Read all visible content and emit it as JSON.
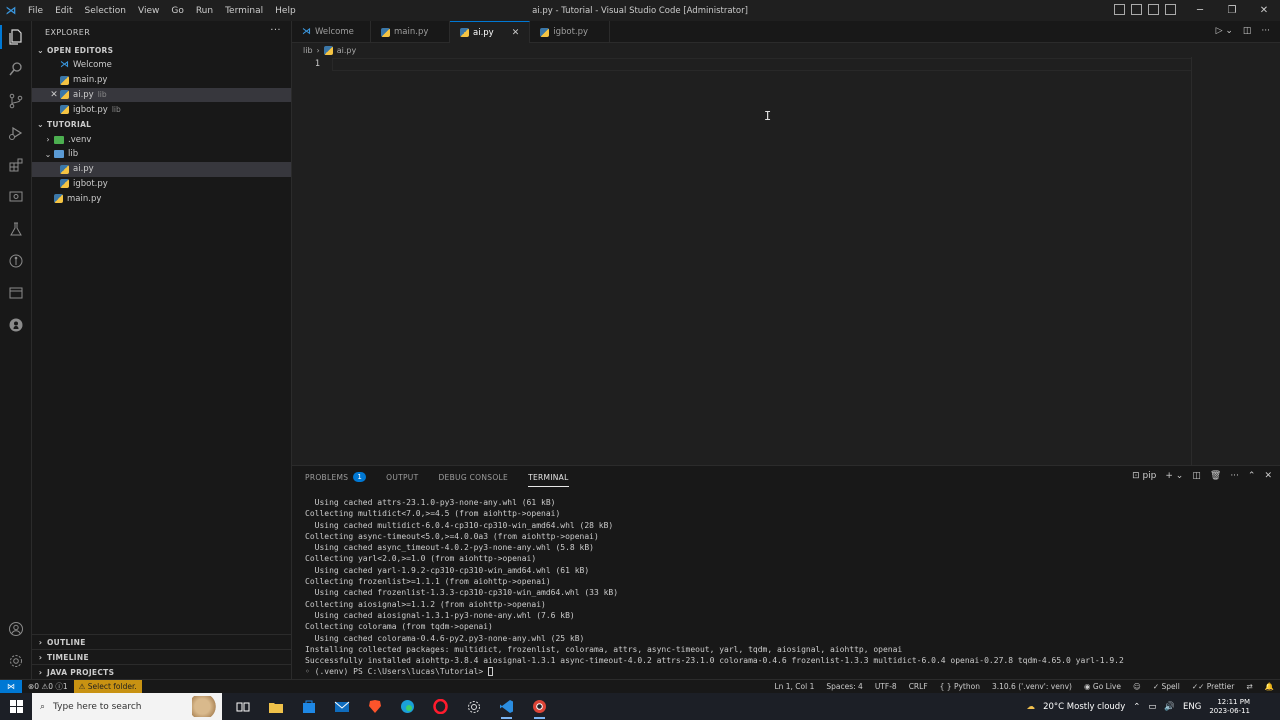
{
  "titlebar": {
    "menu": [
      "File",
      "Edit",
      "Selection",
      "View",
      "Go",
      "Run",
      "Terminal",
      "Help"
    ],
    "title": "ai.py - Tutorial - Visual Studio Code [Administrator]"
  },
  "sidebar": {
    "header": "EXPLORER",
    "open_editors": {
      "label": "OPEN EDITORS",
      "items": [
        {
          "name": "Welcome",
          "path": ""
        },
        {
          "name": "main.py",
          "path": ""
        },
        {
          "name": "ai.py",
          "path": "lib"
        },
        {
          "name": "igbot.py",
          "path": "lib"
        }
      ]
    },
    "workspace": {
      "label": "TUTORIAL",
      "venv": ".venv",
      "lib": "lib",
      "lib_files": [
        "ai.py",
        "igbot.py"
      ],
      "root_files": [
        "main.py"
      ]
    },
    "bottom_sections": [
      "OUTLINE",
      "TIMELINE",
      "JAVA PROJECTS"
    ]
  },
  "tabs": [
    "Welcome",
    "main.py",
    "ai.py",
    "igbot.py"
  ],
  "breadcrumb": {
    "folder": "lib",
    "file": "ai.py"
  },
  "editor": {
    "line_numbers": [
      "1"
    ]
  },
  "panel": {
    "tabs": [
      "PROBLEMS",
      "OUTPUT",
      "DEBUG CONSOLE",
      "TERMINAL"
    ],
    "problems_count": "1",
    "shell": "pip",
    "terminal_lines": [
      "  Using cached attrs-23.1.0-py3-none-any.whl (61 kB)",
      "Collecting multidict<7.0,>=4.5 (from aiohttp->openai)",
      "  Using cached multidict-6.0.4-cp310-cp310-win_amd64.whl (28 kB)",
      "Collecting async-timeout<5.0,>=4.0.0a3 (from aiohttp->openai)",
      "  Using cached async_timeout-4.0.2-py3-none-any.whl (5.8 kB)",
      "Collecting yarl<2.0,>=1.0 (from aiohttp->openai)",
      "  Using cached yarl-1.9.2-cp310-cp310-win_amd64.whl (61 kB)",
      "Collecting frozenlist>=1.1.1 (from aiohttp->openai)",
      "  Using cached frozenlist-1.3.3-cp310-cp310-win_amd64.whl (33 kB)",
      "Collecting aiosignal>=1.1.2 (from aiohttp->openai)",
      "  Using cached aiosignal-1.3.1-py3-none-any.whl (7.6 kB)",
      "Collecting colorama (from tqdm->openai)",
      "  Using cached colorama-0.4.6-py2.py3-none-any.whl (25 kB)",
      "Installing collected packages: multidict, frozenlist, colorama, attrs, async-timeout, yarl, tqdm, aiosignal, aiohttp, openai",
      "Successfully installed aiohttp-3.8.4 aiosignal-1.3.1 async-timeout-4.0.2 attrs-23.1.0 colorama-0.4.6 frozenlist-1.3.3 multidict-6.0.4 openai-0.27.8 tqdm-4.65.0 yarl-1.9.2"
    ],
    "prompt": "(.venv) PS C:\\Users\\lucas\\Tutorial> "
  },
  "statusbar": {
    "errors": "0",
    "warnings": "0",
    "info": "1",
    "select_folder": "Select folder.",
    "position": "Ln 1, Col 1",
    "spaces": "Spaces: 4",
    "encoding": "UTF-8",
    "eol": "CRLF",
    "language": "Python",
    "interpreter": "3.10.6 ('.venv': venv)",
    "go_live": "Go Live",
    "spell": "Spell",
    "prettier": "Prettier"
  },
  "taskbar": {
    "search_placeholder": "Type here to search",
    "weather": "20°C  Mostly cloudy",
    "language": "ENG",
    "time": "12:11 PM",
    "date": "2023-06-11"
  },
  "colors": {
    "accent": "#0078d4",
    "warning": "#c89212",
    "background": "#1f1f1f"
  }
}
